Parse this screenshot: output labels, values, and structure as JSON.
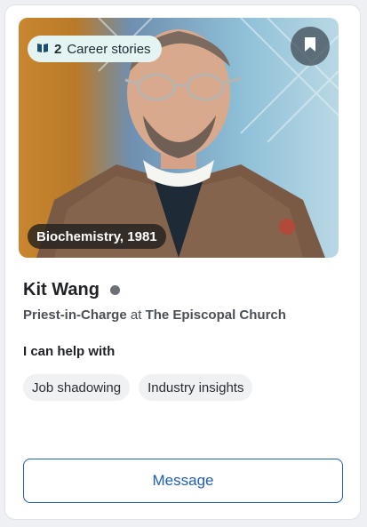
{
  "profile": {
    "career_stories_count": "2",
    "career_stories_label": "Career stories",
    "degree": "Biochemistry, 1981",
    "name": "Kit Wang",
    "status_color": "#6b6f76",
    "role_title": "Priest-in-Charge",
    "role_at": "at",
    "organization": "The Episcopal Church"
  },
  "help": {
    "title": "I can help with",
    "chips": [
      "Job shadowing",
      "Industry insights"
    ]
  },
  "actions": {
    "message_label": "Message"
  },
  "icons": {
    "stories": "book-icon",
    "bookmark": "bookmark-icon"
  },
  "colors": {
    "accent": "#1f5fb0",
    "pill_bg": "#e3f4f3"
  }
}
